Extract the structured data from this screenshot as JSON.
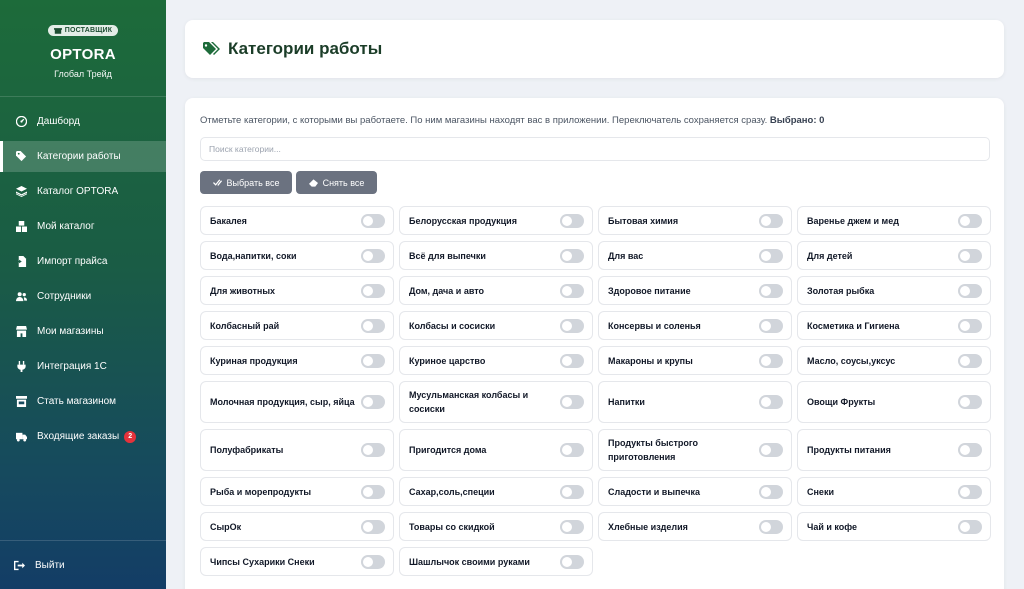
{
  "sidebar": {
    "badge": "ПОСТАВЩИК",
    "brand_name": "OPTORA",
    "company": "Глобал Трейд",
    "items": [
      {
        "label": "Дашборд",
        "icon": "gauge-icon"
      },
      {
        "label": "Категории работы",
        "icon": "tags-icon"
      },
      {
        "label": "Каталог OPTORA",
        "icon": "layers-icon"
      },
      {
        "label": "Мой каталог",
        "icon": "boxes-icon"
      },
      {
        "label": "Импорт прайса",
        "icon": "file-import-icon"
      },
      {
        "label": "Сотрудники",
        "icon": "users-icon"
      },
      {
        "label": "Мои магазины",
        "icon": "store-icon"
      },
      {
        "label": "Интеграция 1С",
        "icon": "plug-icon"
      },
      {
        "label": "Стать магазином",
        "icon": "shop-icon"
      },
      {
        "label": "Входящие заказы",
        "icon": "truck-icon",
        "count": "2"
      }
    ],
    "logout": "Выйти"
  },
  "header": {
    "title": "Категории работы"
  },
  "content": {
    "description": "Отметьте категории, с которыми вы работаете. По ним магазины находят вас в приложении. Переключатель сохраняется сразу.",
    "selected_label": "Выбрано: 0",
    "search_placeholder": "Поиск категории...",
    "select_all": "Выбрать все",
    "deselect_all": "Снять все"
  },
  "categories": [
    "Бакалея",
    "Белорусская продукция",
    "Бытовая химия",
    "Варенье джем и мед",
    "Вода,напитки, соки",
    "Всё для выпечки",
    "Для вас",
    "Для детей",
    "Для животных",
    "Дом, дача и авто",
    "Здоровое питание",
    "Золотая рыбка",
    "Колбасный рай",
    "Колбасы и сосиски",
    "Консервы и соленья",
    "Косметика и Гигиена",
    "Куриная продукция",
    "Куриное царство",
    "Макароны и крупы",
    "Масло, соусы,уксус",
    "Молочная продукция, сыр, яйца",
    "Мусульманская колбасы и сосиски",
    "Напитки",
    "Овощи Фрукты",
    "Полуфабрикаты",
    "Пригодится дома",
    "Продукты быстрого приготовления",
    "Продукты питания",
    "Рыба и морепродукты",
    "Сахар,соль,специи",
    "Сладости и выпечка",
    "Снеки",
    "СырОк",
    "Товары со скидкой",
    "Хлебные изделия",
    "Чай и кофе",
    "Чипсы Сухарики Снеки",
    "Шашлычок своими руками"
  ],
  "colors": {
    "accent": "#1d6b3a",
    "title": "#1b3d28",
    "toggle_off": "#d1d5db",
    "badge_red": "#e5323b"
  }
}
